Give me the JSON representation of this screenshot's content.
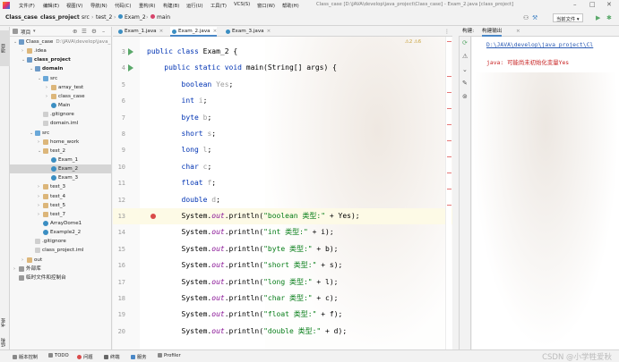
{
  "window": {
    "title": "Class_case [D:\\JAVA\\develop\\java_project\\Class_case] - Exam_2.java [class_project]"
  },
  "menu": [
    "文件(F)",
    "编辑(E)",
    "视图(V)",
    "导航(N)",
    "代码(C)",
    "重构(R)",
    "构建(B)",
    "运行(U)",
    "工具(T)",
    "VCS(S)",
    "窗口(W)",
    "帮助(H)"
  ],
  "breadcrumb": [
    "Class_case",
    "class_project",
    "src",
    "test_2",
    "Exam_2",
    "main"
  ],
  "toolbar": {
    "run_config": "当前文件"
  },
  "project_panel": {
    "title": "项目",
    "tree": [
      {
        "label": "Class_case",
        "sub": "D:\\JAVA\\develop\\java_",
        "icon": "module",
        "depth": 0,
        "open": true
      },
      {
        "label": ".idea",
        "icon": "folder",
        "depth": 1,
        "open": false
      },
      {
        "label": "class_project",
        "icon": "module",
        "depth": 1,
        "open": true,
        "bold": true
      },
      {
        "label": "domain",
        "icon": "module",
        "depth": 2,
        "open": true,
        "bold": true
      },
      {
        "label": "src",
        "icon": "src",
        "depth": 3,
        "open": true
      },
      {
        "label": "array_test",
        "icon": "folder",
        "depth": 4,
        "open": false
      },
      {
        "label": "class_case",
        "icon": "folder",
        "depth": 4,
        "open": false
      },
      {
        "label": "Main",
        "icon": "java",
        "depth": 4
      },
      {
        "label": ".gitignore",
        "icon": "file",
        "depth": 3
      },
      {
        "label": "domain.iml",
        "icon": "file",
        "depth": 3
      },
      {
        "label": "src",
        "icon": "src",
        "depth": 2,
        "open": true
      },
      {
        "label": "home_work",
        "icon": "folder",
        "depth": 3,
        "open": false
      },
      {
        "label": "test_2",
        "icon": "folder",
        "depth": 3,
        "open": true
      },
      {
        "label": "Exam_1",
        "icon": "java",
        "depth": 4
      },
      {
        "label": "Exam_2",
        "icon": "java",
        "depth": 4,
        "selected": true
      },
      {
        "label": "Exam_3",
        "icon": "java",
        "depth": 4
      },
      {
        "label": "test_3",
        "icon": "folder",
        "depth": 3,
        "open": false
      },
      {
        "label": "test_4",
        "icon": "folder",
        "depth": 3,
        "open": false
      },
      {
        "label": "test_5",
        "icon": "folder",
        "depth": 3,
        "open": false
      },
      {
        "label": "test_7",
        "icon": "folder",
        "depth": 3,
        "open": false
      },
      {
        "label": "ArrayDome1",
        "icon": "java",
        "depth": 3
      },
      {
        "label": "Example2_2",
        "icon": "java",
        "depth": 3
      },
      {
        "label": ".gitignore",
        "icon": "file",
        "depth": 2
      },
      {
        "label": "class_project.iml",
        "icon": "file",
        "depth": 2
      },
      {
        "label": "out",
        "icon": "folder",
        "depth": 1,
        "open": false
      },
      {
        "label": "外部库",
        "icon": "lib",
        "depth": 0,
        "open": false
      },
      {
        "label": "临时文件和控制台",
        "icon": "lib",
        "depth": 0
      }
    ]
  },
  "left_stripe": {
    "top": "项目",
    "middle": "书签",
    "bottom": "结构"
  },
  "editor_tabs": [
    {
      "label": "Exam_1.java",
      "active": false
    },
    {
      "label": "Exam_2.java",
      "active": true
    },
    {
      "label": "Exam_3.java",
      "active": false
    }
  ],
  "editor": {
    "problem_counts": "⚠2  ⚠6",
    "lines": [
      {
        "n": "3",
        "run": true,
        "tokens": [
          [
            "kw",
            "public class "
          ],
          [
            "var",
            "Exam_2 {"
          ]
        ]
      },
      {
        "n": "4",
        "run": true,
        "tokens": [
          [
            "var",
            "    "
          ],
          [
            "kw",
            "public static void "
          ],
          [
            "var",
            "main(String[] args) {"
          ]
        ]
      },
      {
        "n": "5",
        "tokens": [
          [
            "var",
            "        "
          ],
          [
            "kw",
            "boolean "
          ],
          [
            "unused",
            "Yes"
          ],
          [
            "var",
            ";"
          ]
        ]
      },
      {
        "n": "6",
        "tokens": [
          [
            "var",
            "        "
          ],
          [
            "kw",
            "int "
          ],
          [
            "unused",
            "i"
          ],
          [
            "var",
            ";"
          ]
        ]
      },
      {
        "n": "7",
        "tokens": [
          [
            "var",
            "        "
          ],
          [
            "kw",
            "byte "
          ],
          [
            "unused",
            "b"
          ],
          [
            "var",
            ";"
          ]
        ]
      },
      {
        "n": "8",
        "tokens": [
          [
            "var",
            "        "
          ],
          [
            "kw",
            "short "
          ],
          [
            "unused",
            "s"
          ],
          [
            "var",
            ";"
          ]
        ]
      },
      {
        "n": "9",
        "tokens": [
          [
            "var",
            "        "
          ],
          [
            "kw",
            "long "
          ],
          [
            "unused",
            "l"
          ],
          [
            "var",
            ";"
          ]
        ]
      },
      {
        "n": "10",
        "tokens": [
          [
            "var",
            "        "
          ],
          [
            "kw",
            "char "
          ],
          [
            "unused",
            "c"
          ],
          [
            "var",
            ";"
          ]
        ]
      },
      {
        "n": "11",
        "tokens": [
          [
            "var",
            "        "
          ],
          [
            "kw",
            "float "
          ],
          [
            "unused",
            "f"
          ],
          [
            "var",
            ";"
          ]
        ]
      },
      {
        "n": "12",
        "tokens": [
          [
            "var",
            "        "
          ],
          [
            "kw",
            "double "
          ],
          [
            "unused",
            "d"
          ],
          [
            "var",
            ";"
          ]
        ]
      },
      {
        "n": "13",
        "current": true,
        "bulb": true,
        "tokens": [
          [
            "var",
            "        System."
          ],
          [
            "st",
            "out"
          ],
          [
            "var",
            ".println("
          ],
          [
            "str",
            "\"boolean 类型:\""
          ],
          [
            "var",
            " + Yes);"
          ]
        ]
      },
      {
        "n": "14",
        "tokens": [
          [
            "var",
            "        System."
          ],
          [
            "st",
            "out"
          ],
          [
            "var",
            ".println("
          ],
          [
            "str",
            "\"int 类型:\""
          ],
          [
            "var",
            " + i);"
          ]
        ]
      },
      {
        "n": "15",
        "tokens": [
          [
            "var",
            "        System."
          ],
          [
            "st",
            "out"
          ],
          [
            "var",
            ".println("
          ],
          [
            "str",
            "\"byte 类型:\""
          ],
          [
            "var",
            " + b);"
          ]
        ]
      },
      {
        "n": "16",
        "tokens": [
          [
            "var",
            "        System."
          ],
          [
            "st",
            "out"
          ],
          [
            "var",
            ".println("
          ],
          [
            "str",
            "\"short 类型:\""
          ],
          [
            "var",
            " + s);"
          ]
        ]
      },
      {
        "n": "17",
        "tokens": [
          [
            "var",
            "        System."
          ],
          [
            "st",
            "out"
          ],
          [
            "var",
            ".println("
          ],
          [
            "str",
            "\"long 类型:\""
          ],
          [
            "var",
            " + l);"
          ]
        ]
      },
      {
        "n": "18",
        "tokens": [
          [
            "var",
            "        System."
          ],
          [
            "st",
            "out"
          ],
          [
            "var",
            ".println("
          ],
          [
            "str",
            "\"char 类型:\""
          ],
          [
            "var",
            " + c);"
          ]
        ]
      },
      {
        "n": "19",
        "tokens": [
          [
            "var",
            "        System."
          ],
          [
            "st",
            "out"
          ],
          [
            "var",
            ".println("
          ],
          [
            "str",
            "\"float 类型:\""
          ],
          [
            "var",
            " + f);"
          ]
        ]
      },
      {
        "n": "20",
        "tokens": [
          [
            "var",
            "        System."
          ],
          [
            "st",
            "out"
          ],
          [
            "var",
            ".println("
          ],
          [
            "str",
            "\"double 类型:\""
          ],
          [
            "var",
            " + d);"
          ]
        ]
      }
    ]
  },
  "build_panel": {
    "tabs": [
      "构建:",
      "构建输出"
    ],
    "path": "D:\\JAVA\\develop\\java_project\\Cl",
    "error": "java: 可能尚未初始化变量Yes"
  },
  "status_bar": {
    "items": [
      "版本控制",
      "TODO",
      "问题",
      "终端",
      "服务",
      "Profiler"
    ]
  },
  "watermark": "CSDN @小学牲爱秋",
  "colors": {
    "keyword": "#0033b3",
    "string": "#067d17",
    "static_field": "#871094",
    "error": "#c82424",
    "link": "#2a5ab3",
    "run_icon": "#59a869"
  }
}
